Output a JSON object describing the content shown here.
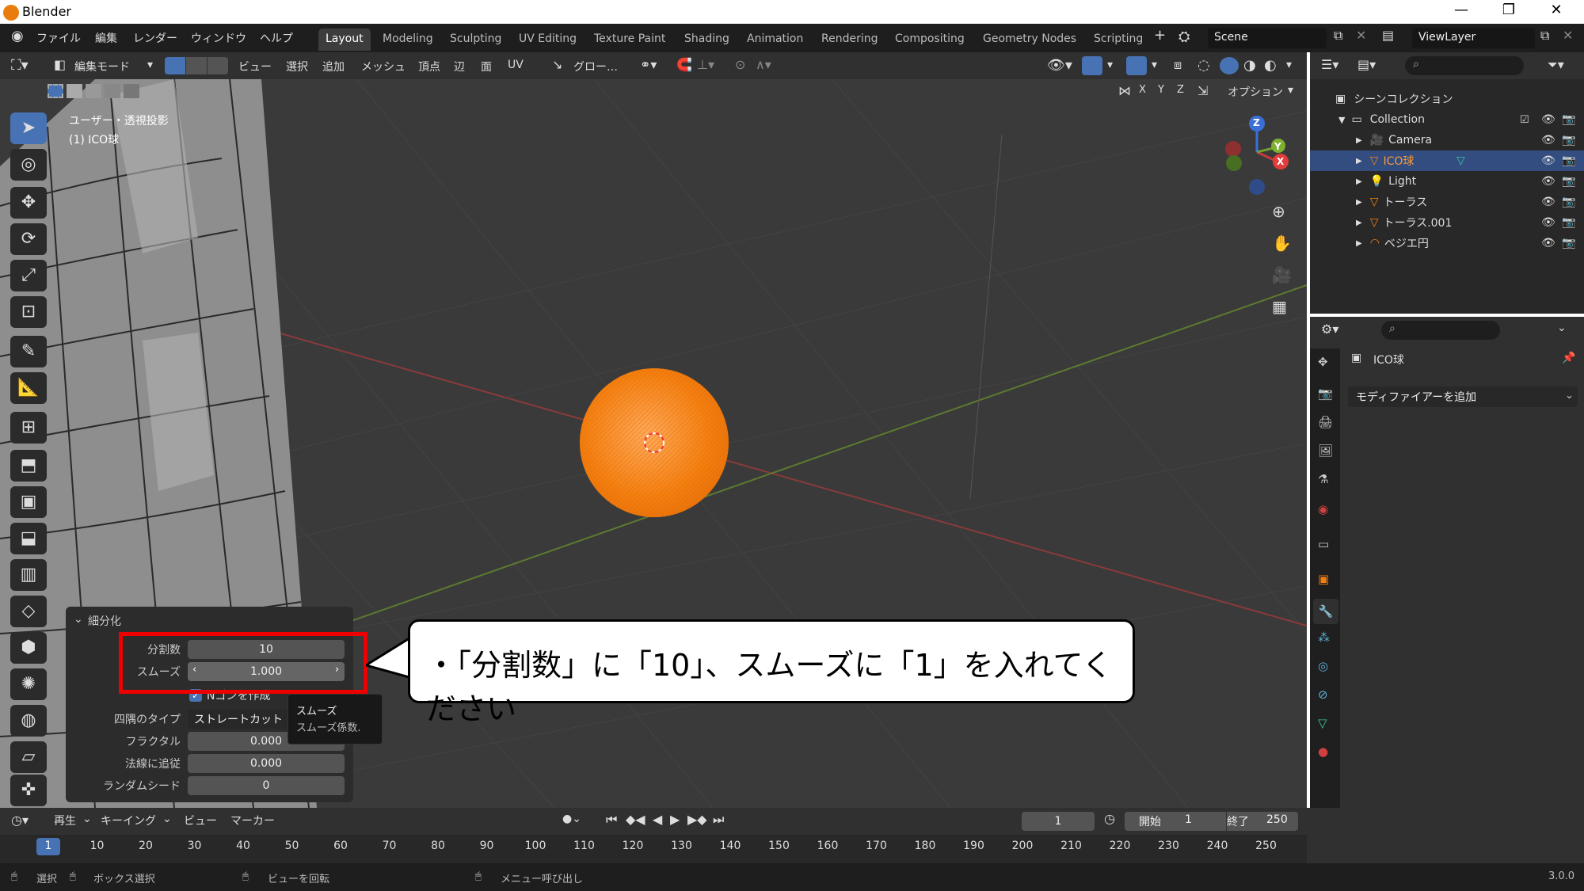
{
  "window": {
    "title": "Blender",
    "controls": [
      "—",
      "❐",
      "✕"
    ]
  },
  "menubar": {
    "menus": [
      "ファイル",
      "編集",
      "レンダー",
      "ウィンドウ",
      "ヘルプ"
    ],
    "workspaces": [
      "Layout",
      "Modeling",
      "Sculpting",
      "UV Editing",
      "Texture Paint",
      "Shading",
      "Animation",
      "Rendering",
      "Compositing",
      "Geometry Nodes",
      "Scripting"
    ],
    "active_workspace": "Layout",
    "add_tab": "+",
    "scene": "Scene",
    "view_layer": "ViewLayer"
  },
  "viewport_header": {
    "mode": "編集モード",
    "menus": [
      "ビュー",
      "選択",
      "追加",
      "メッシュ",
      "頂点",
      "辺",
      "面",
      "UV"
    ],
    "transform": "グロー…",
    "axes": [
      "X",
      "Y",
      "Z"
    ],
    "options": "オプション"
  },
  "viewport": {
    "view_name": "ユーザー・透視投影",
    "object_label": "(1) ICO球",
    "sphere_color": "#f47e0e",
    "gizmo": {
      "z": "Z",
      "y": "Y",
      "x": "X"
    }
  },
  "redo_panel": {
    "title": "細分化",
    "fields": [
      {
        "label": "分割数",
        "value": "10"
      },
      {
        "label": "スムーズ",
        "value": "1.000"
      }
    ],
    "checkbox_label": "Nゴンを作成",
    "corner_type_label": "四隅のタイプ",
    "corner_type_value": "ストレートカット",
    "fractal_label": "フラクタル",
    "fractal_value": "0.000",
    "normal_label": "法線に追従",
    "normal_value": "0.000",
    "seed_label": "ランダムシード",
    "seed_value": "0"
  },
  "tooltip": {
    "line1": "スムーズ",
    "line2": "スムーズ係数."
  },
  "callout": {
    "text": "・「分割数」に「10」、スムーズに「1」を入れてください"
  },
  "outliner": {
    "scene_collection": "シーンコレクション",
    "collection": "Collection",
    "items": [
      "Camera",
      "ICO球",
      "Light",
      "トーラス",
      "トーラス.001",
      "ベジエ円"
    ],
    "selected": "ICO球"
  },
  "properties": {
    "object_name": "ICO球",
    "add_modifier": "モディファイアーを追加"
  },
  "timeline": {
    "menus": [
      "再生",
      "キーイング",
      "ビュー",
      "マーカー"
    ],
    "current_frame": "1",
    "start_label": "開始",
    "start": "1",
    "end_label": "終了",
    "end": "250",
    "ticks": [
      "1",
      "10",
      "20",
      "30",
      "40",
      "50",
      "60",
      "70",
      "80",
      "90",
      "100",
      "110",
      "120",
      "130",
      "140",
      "150",
      "160",
      "170",
      "180",
      "190",
      "200",
      "210",
      "220",
      "230",
      "240",
      "250"
    ]
  },
  "status": {
    "select": "選択",
    "box_select": "ボックス選択",
    "rotate_view": "ビューを回転",
    "call_menu": "メニュー呼び出し",
    "version": "3.0.0"
  }
}
